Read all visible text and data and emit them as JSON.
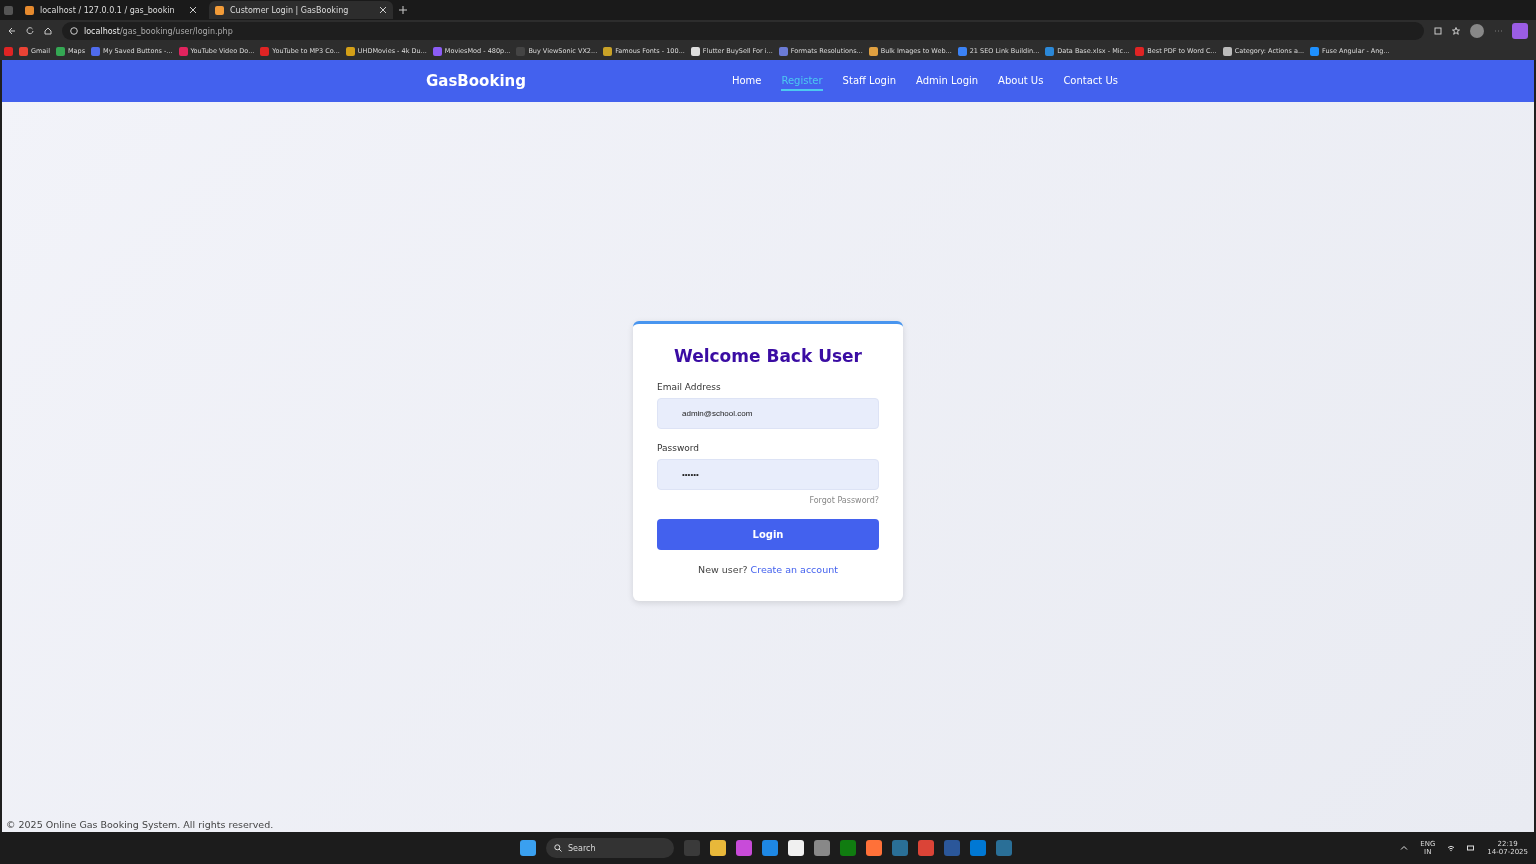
{
  "browser": {
    "tabs": [
      {
        "title": "localhost / 127.0.0.1 / gas_bookin",
        "selected": false
      },
      {
        "title": "Customer Login | GasBooking",
        "selected": true
      }
    ],
    "address": {
      "host": "localhost",
      "path": "/gas_booking/user/login.php"
    },
    "bookmarks": [
      {
        "color": "#e02424"
      },
      {
        "label": "Gmail",
        "color": "#ea4335"
      },
      {
        "label": "Maps",
        "color": "#34a853"
      },
      {
        "label": "My Saved Buttons -...",
        "color": "#4f6bed"
      },
      {
        "label": "YouTube Video Do...",
        "color": "#e0245e"
      },
      {
        "label": "YouTube to MP3 Co...",
        "color": "#e02424"
      },
      {
        "label": "UHDMovies - 4k Du...",
        "color": "#d4a017"
      },
      {
        "label": "MoviesMod - 480p...",
        "color": "#8b5cf6"
      },
      {
        "label": "Buy ViewSonic VX2...",
        "color": "#444444"
      },
      {
        "label": "Famous Fonts - 100...",
        "color": "#c9a227"
      },
      {
        "label": "Flutter BuySell For i...",
        "color": "#dddddd"
      },
      {
        "label": "Formats Resolutions...",
        "color": "#6b7bd6"
      },
      {
        "label": "Bulk Images to Web...",
        "color": "#e0a040"
      },
      {
        "label": "21 SEO Link Buildin...",
        "color": "#3b82f6"
      },
      {
        "label": "Data Base.xlsx - Mic...",
        "color": "#2b88d8"
      },
      {
        "label": "Best PDF to Word C...",
        "color": "#e02424"
      },
      {
        "label": "Category: Actions a...",
        "color": "#bbbbbb"
      },
      {
        "label": "Fuse Angular - Ang...",
        "color": "#1e90ff"
      }
    ]
  },
  "navbar": {
    "brand": "GasBooking",
    "links": [
      {
        "label": "Home",
        "selected": false
      },
      {
        "label": "Register",
        "selected": true
      },
      {
        "label": "Staff Login",
        "selected": false
      },
      {
        "label": "Admin Login",
        "selected": false
      },
      {
        "label": "About Us",
        "selected": false
      },
      {
        "label": "Contact Us",
        "selected": false
      }
    ]
  },
  "login_card": {
    "title": "Welcome Back User",
    "fields": [
      {
        "label": "Email Address",
        "value": "admin@school.com"
      },
      {
        "label": "Password",
        "value": "••••••"
      }
    ],
    "forgot_link": "Forgot Password?",
    "submit": "Login",
    "signup_prompt": "New user?",
    "signup_link": "Create an account"
  },
  "footer": "© 2025 Online Gas Booking System. All rights reserved.",
  "taskbar": {
    "search": "Search",
    "language": "ENG",
    "region": "IN",
    "time": "22:19",
    "date": "14-07-2025"
  }
}
